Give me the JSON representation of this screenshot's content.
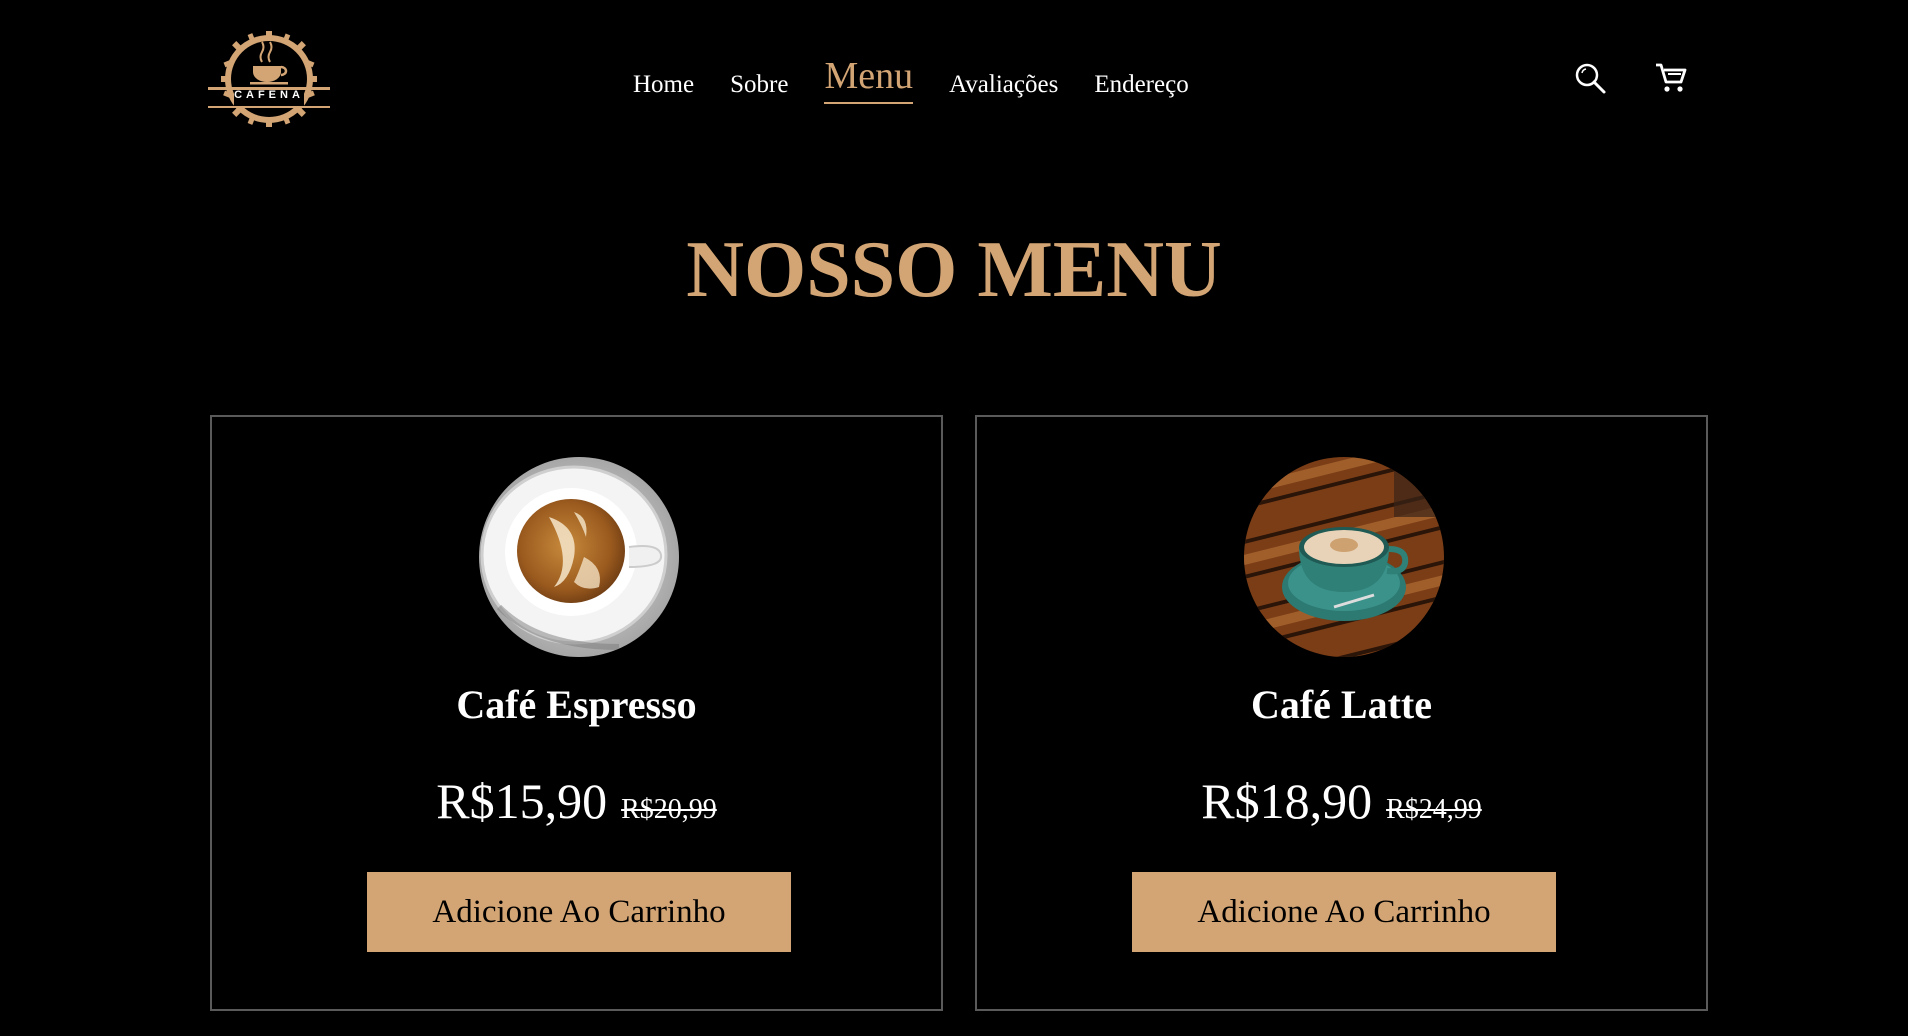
{
  "header": {
    "logo_text": "CAFENA",
    "nav": [
      {
        "label": "Home",
        "active": false
      },
      {
        "label": "Sobre",
        "active": false
      },
      {
        "label": "Menu",
        "active": true
      },
      {
        "label": "Avaliações",
        "active": false
      },
      {
        "label": "Endereço",
        "active": false
      }
    ],
    "icons": {
      "search": "search-icon",
      "cart": "cart-icon"
    }
  },
  "menu": {
    "title": "NOSSO MENU",
    "items": [
      {
        "name": "Café Espresso",
        "price": "R$15,90",
        "old_price": "R$20,99",
        "button_label": "Adicione Ao Carrinho",
        "image": "latte-art-cup-top-view"
      },
      {
        "name": "Café Latte",
        "price": "R$18,90",
        "old_price": "R$24,99",
        "button_label": "Adicione Ao Carrinho",
        "image": "cappuccino-teal-cup-on-wooden-table"
      }
    ]
  },
  "colors": {
    "background": "#000000",
    "accent": "#d3a574",
    "text": "#ffffff",
    "card_border": "#5a5a5a"
  }
}
